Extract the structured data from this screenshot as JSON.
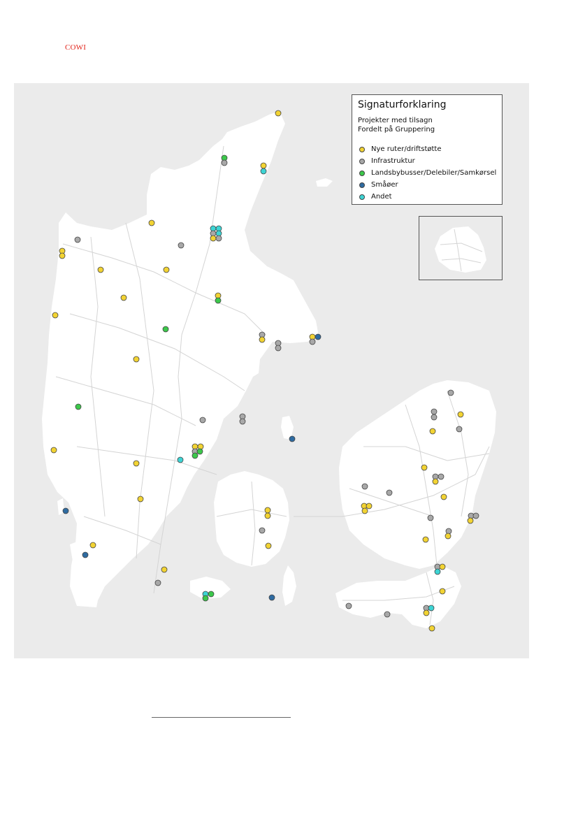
{
  "header": {
    "logo_text": "COWI"
  },
  "legend": {
    "title": "Signaturforklaring",
    "subtitle_line1": "Projekter med tilsagn",
    "subtitle_line2": "Fordelt på Gruppering",
    "items": [
      {
        "label": "Nye ruter/driftstøtte",
        "color": "#f2d333"
      },
      {
        "label": "Infrastruktur",
        "color": "#a8a8a8"
      },
      {
        "label": "Landsbybusser/Delebiler/Samkørsel",
        "color": "#3cc84b"
      },
      {
        "label": "Småøer",
        "color": "#2e6ba1"
      },
      {
        "label": "Andet",
        "color": "#3dd4d4"
      }
    ]
  },
  "map": {
    "land_color": "#ffffff",
    "sea_color": "#ebebeb",
    "road_color": "#d4d4d4"
  }
}
